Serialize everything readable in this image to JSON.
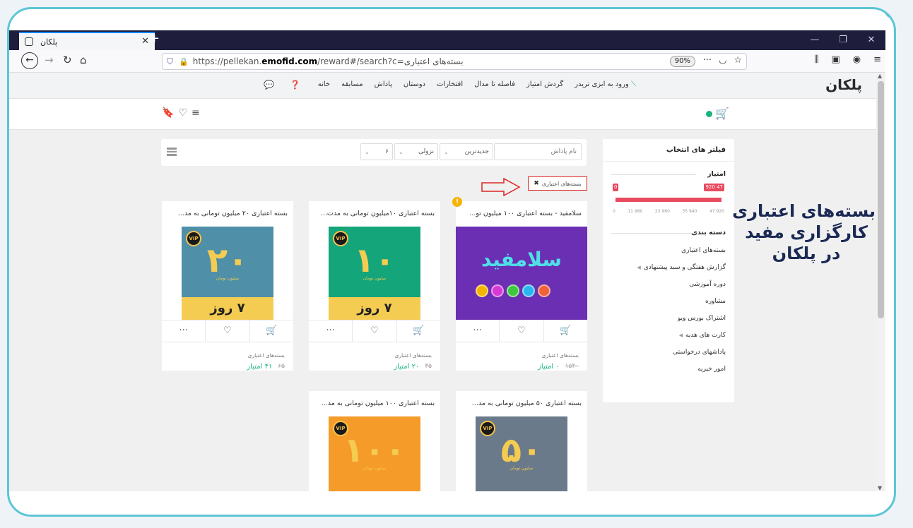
{
  "browser": {
    "tab_title": "پلکان",
    "url_prefix": "https://pellekan.",
    "url_domain": "emofid.com",
    "url_path": "/reward#/search?c=بسته‌های اعتباری",
    "zoom": "90%"
  },
  "site": {
    "logo": "پلکان",
    "nav": [
      "خانه",
      "مسابقه",
      "پاداش",
      "دوستان",
      "افتخارات",
      "فاصله تا مدال",
      "گردش امتیاز",
      "ورود به ابزی تریدر"
    ]
  },
  "toolbar": {
    "name_placeholder": "نام پاداش",
    "sort_label": "جدیدترین",
    "order_label": "نزولی",
    "page_size": "۶"
  },
  "active_filter": "بسته‌های اعتباری",
  "sidebar": {
    "title": "فیلتر های انتخاب",
    "score_label": "امتیاز",
    "range_min": "0",
    "range_max": "47 920",
    "ticks": [
      "0",
      "11 980",
      "23 960",
      "35 940",
      "47 920"
    ],
    "category_label": "دسته بندی",
    "categories": [
      {
        "label": "بسته‌های اعتباری",
        "expandable": false
      },
      {
        "label": "گزارش هفتگی و سبد پیشنهادی",
        "expandable": true
      },
      {
        "label": "دوره آموزشی",
        "expandable": false
      },
      {
        "label": "مشاوره",
        "expandable": false
      },
      {
        "label": "اشتراک بورس ویو",
        "expandable": false
      },
      {
        "label": "کارت های هدیه",
        "expandable": true
      },
      {
        "label": "پاداشهای درخواستی",
        "expandable": false
      },
      {
        "label": "امور خیریه",
        "expandable": false
      }
    ]
  },
  "cards": [
    {
      "title": "سلامفید - بسته اعتباری ۱۰۰ میلیون تو...",
      "category": "بسته‌های اعتباری",
      "old_price": "۱۵۴۰",
      "price": "۰ امتیاز",
      "image_text": "سلامفید",
      "bg": "#6a2fb3"
    },
    {
      "title": "بسته اعتباری ۱۰میلیون تومانی به مدت...",
      "category": "بسته‌های اعتباری",
      "old_price": "۳۵",
      "price": "۲۰ امتیاز",
      "image_text": "۱۰",
      "image_sub": "میلیون تومان",
      "days": "۷ روز",
      "bg": "#14a57a"
    },
    {
      "title": "بسته اعتباری ۲۰ میلیون تومانی به مد...",
      "category": "بسته‌های اعتباری",
      "old_price": "۶۵",
      "price": "۴۱ امتیاز",
      "image_text": "۲۰",
      "image_sub": "میلیون تومان",
      "days": "۷ روز",
      "bg": "#4f8fa8"
    },
    {
      "title": "بسته اعتباری ۵۰ میلیون تومانی به مد...",
      "image_text": "۵۰",
      "image_sub": "میلیون تومان",
      "bg": "#6b7a8a"
    },
    {
      "title": "بسته اعتباری ۱۰۰ میلیون تومانی به مد...",
      "image_text": "۱۰۰",
      "image_sub": "میلیون تومان",
      "bg": "#f59b2a"
    }
  ],
  "vip_label": "VIP",
  "overlay_text": [
    "بسته‌های اعتباری",
    "کارگزاری مفید",
    "در پلکان"
  ],
  "colors": {
    "accent": "#16b37f",
    "range": "#e84a5f",
    "frame": "#5cc6d6",
    "title": "#1b2a55"
  }
}
